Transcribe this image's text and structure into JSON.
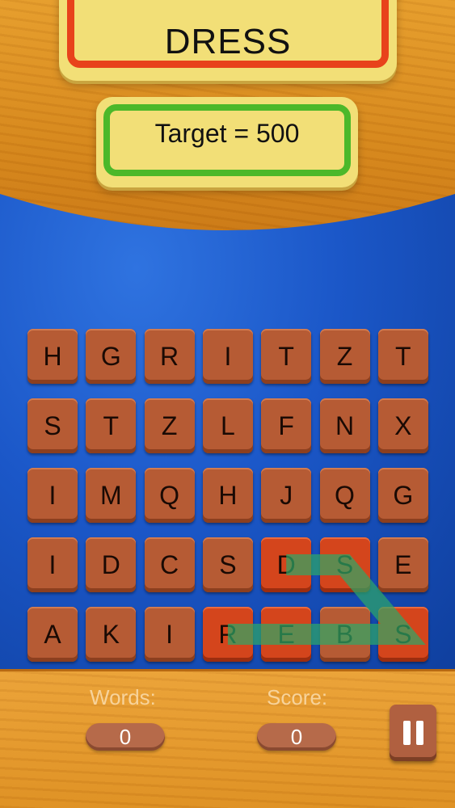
{
  "header": {
    "current_word": "DRESS",
    "target_label": "Target = 500"
  },
  "board": {
    "rows": [
      [
        "H",
        "G",
        "R",
        "I",
        "T",
        "Z",
        "T"
      ],
      [
        "S",
        "T",
        "Z",
        "L",
        "F",
        "N",
        "X"
      ],
      [
        "I",
        "M",
        "Q",
        "H",
        "J",
        "Q",
        "G"
      ],
      [
        "I",
        "D",
        "C",
        "S",
        "D",
        "S",
        "E"
      ],
      [
        "A",
        "K",
        "I",
        "R",
        "E",
        "B",
        "S"
      ]
    ],
    "selected_path": [
      [
        3,
        4
      ],
      [
        3,
        5
      ],
      [
        4,
        6
      ],
      [
        4,
        4
      ],
      [
        4,
        3
      ]
    ]
  },
  "footer": {
    "words_label": "Words:",
    "words_value": "0",
    "score_label": "Score:",
    "score_value": "0",
    "pause_icon": "pause-icon"
  },
  "colors": {
    "tile": "#b65b34",
    "tile_selected": "#d4451c",
    "path": "#2ea866",
    "target_border": "#4cb82a",
    "word_border": "#e8421b"
  }
}
